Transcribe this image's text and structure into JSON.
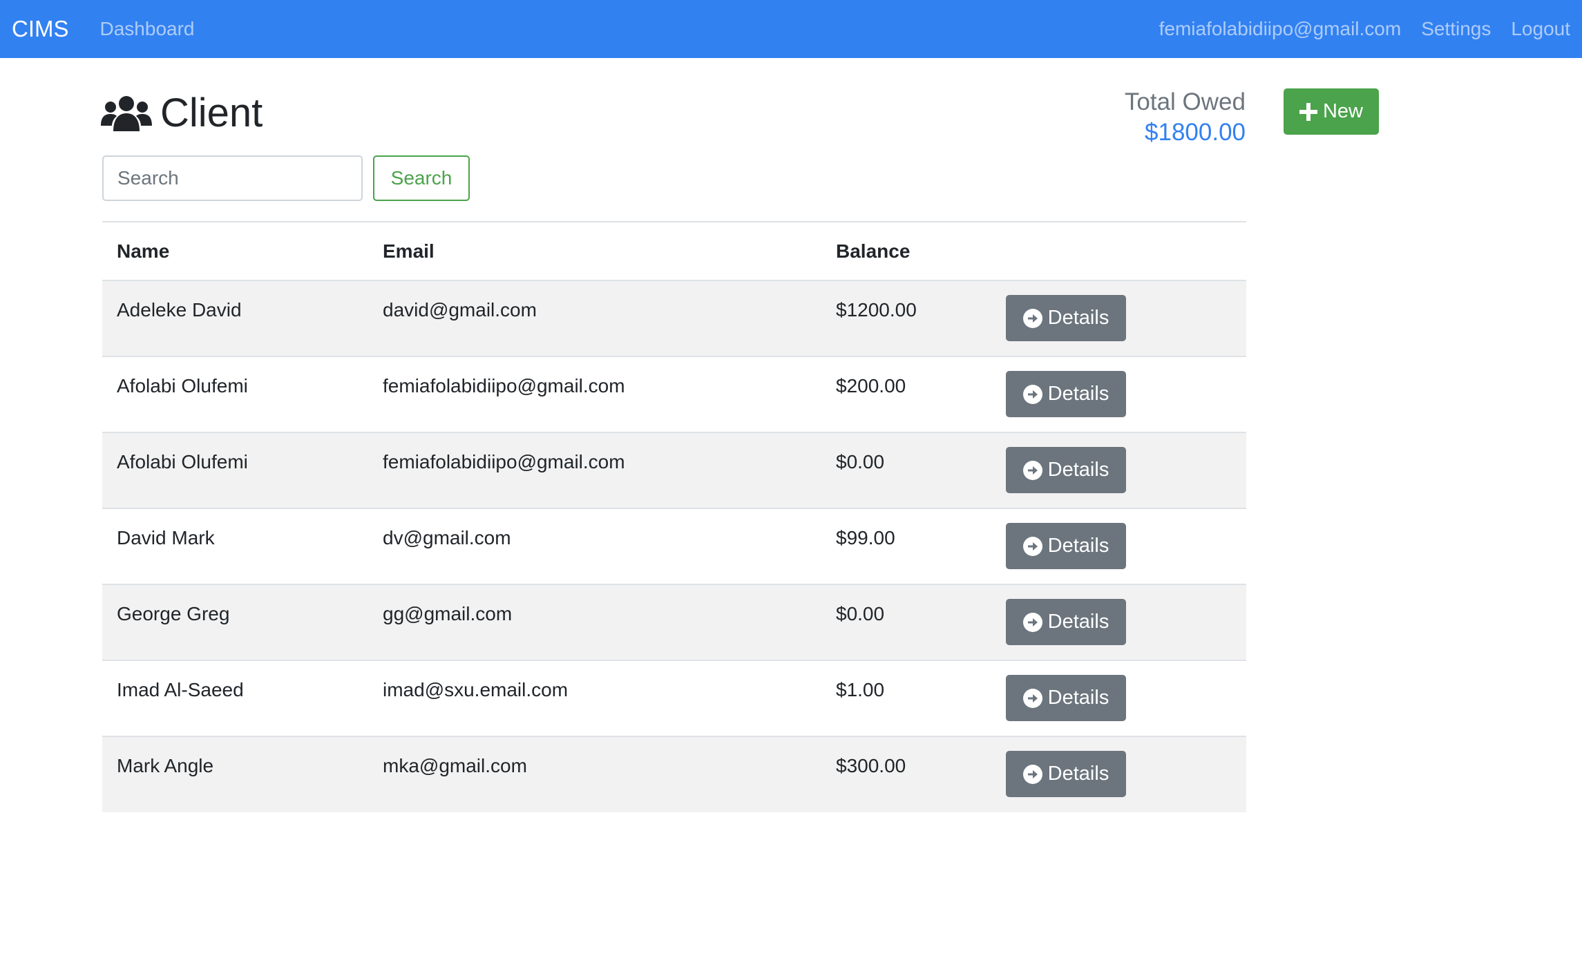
{
  "nav": {
    "brand": "CIMS",
    "dashboard": "Dashboard",
    "user_email": "femiafolabidiipo@gmail.com",
    "settings": "Settings",
    "logout": "Logout"
  },
  "header": {
    "title": "Client",
    "title_icon": "users-icon",
    "total_label": "Total Owed",
    "total_value": "$1800.00",
    "new_button": "New"
  },
  "search": {
    "placeholder": "Search",
    "button": "Search"
  },
  "table": {
    "columns": [
      "Name",
      "Email",
      "Balance",
      ""
    ],
    "rows": [
      {
        "name": "Adeleke David",
        "email": "david@gmail.com",
        "balance": "$1200.00",
        "action": "Details"
      },
      {
        "name": "Afolabi Olufemi",
        "email": "femiafolabidiipo@gmail.com",
        "balance": "$200.00",
        "action": "Details"
      },
      {
        "name": "Afolabi Olufemi",
        "email": "femiafolabidiipo@gmail.com",
        "balance": "$0.00",
        "action": "Details"
      },
      {
        "name": "David Mark",
        "email": "dv@gmail.com",
        "balance": "$99.00",
        "action": "Details"
      },
      {
        "name": "George Greg",
        "email": "gg@gmail.com",
        "balance": "$0.00",
        "action": "Details"
      },
      {
        "name": "Imad Al-Saeed",
        "email": "imad@sxu.email.com",
        "balance": "$1.00",
        "action": "Details"
      },
      {
        "name": "Mark Angle",
        "email": "mka@gmail.com",
        "balance": "$300.00",
        "action": "Details"
      }
    ]
  },
  "colors": {
    "navbar": "#3281f1",
    "success": "#4ba34b",
    "secondary": "#6c757d",
    "accent_value": "#3281f1"
  }
}
